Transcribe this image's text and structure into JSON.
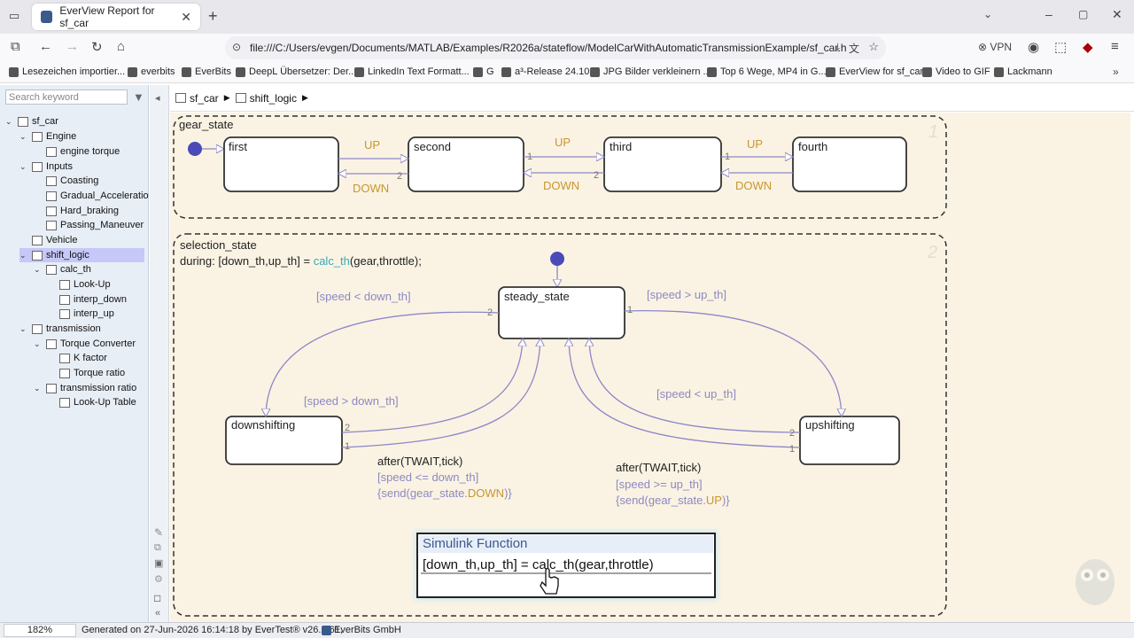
{
  "browser": {
    "tab_title": "EverView Report for sf_car",
    "url": "file:///C:/Users/evgen/Documents/MATLAB/Examples/R2026a/stateflow/ModelCarWithAutomaticTransmissionExample/sf_car.h",
    "vpn_label": "VPN",
    "bookmarks": [
      "Lesezeichen importier...",
      "everbits",
      "EverBits",
      "DeepL Übersetzer: Der...",
      "LinkedIn Text Formatt...",
      "G",
      "a³-Release 24.10",
      "JPG Bilder verkleinern ...",
      "Top 6 Wege, MP4 in G...",
      "EverView for sf_car",
      "Video to GIF",
      "Lackmann"
    ]
  },
  "sidebar": {
    "search_placeholder": "Search keyword",
    "tree": [
      {
        "label": "sf_car"
      },
      {
        "label": "Engine"
      },
      {
        "label": "engine torque"
      },
      {
        "label": "Inputs"
      },
      {
        "label": "Coasting"
      },
      {
        "label": "Gradual_Acceleratio"
      },
      {
        "label": "Hard_braking"
      },
      {
        "label": "Passing_Maneuver"
      },
      {
        "label": "Vehicle"
      },
      {
        "label": "shift_logic"
      },
      {
        "label": "calc_th"
      },
      {
        "label": "Look-Up"
      },
      {
        "label": "interp_down"
      },
      {
        "label": "interp_up"
      },
      {
        "label": "transmission"
      },
      {
        "label": "Torque Converter"
      },
      {
        "label": "K factor"
      },
      {
        "label": "Torque ratio"
      },
      {
        "label": "transmission ratio"
      },
      {
        "label": "Look-Up Table"
      }
    ]
  },
  "breadcrumb": {
    "root": "sf_car",
    "current": "shift_logic"
  },
  "diagram": {
    "gear_state": {
      "title": "gear_state",
      "num": "1",
      "states": [
        "first",
        "second",
        "third",
        "fourth"
      ],
      "up": "UP",
      "down": "DOWN",
      "p1": "1",
      "p2": "2"
    },
    "selection_state": {
      "title": "selection_state",
      "num": "2",
      "during_prefix": "during: [down_th,up_th] = ",
      "during_fn": "calc_th",
      "during_suffix": "(gear,throttle);",
      "steady": "steady_state",
      "down": "downshifting",
      "up": "upshifting",
      "g_lt_down": "[speed < down_th]",
      "g_gt_up": "[speed > up_th]",
      "g_gt_down": "[speed > down_th]",
      "g_lt_up": "[speed < up_th]",
      "down_act": [
        "after(TWAIT,tick)",
        "[speed <= down_th]",
        "{send(gear_state.",
        "DOWN",
        ")}"
      ],
      "up_act": [
        "after(TWAIT,tick)",
        "[speed >= up_th]",
        "{send(gear_state.",
        "UP",
        ")}"
      ]
    },
    "function": {
      "title": "Simulink Function",
      "signature": "[down_th,up_th] = calc_th(gear,throttle)"
    }
  },
  "status": {
    "zoom": "182%",
    "generated": "Generated on 27-Jun-2026 16:14:18 by EverTest® v26.1.61,",
    "company": "EverBits GmbH"
  },
  "colors": {
    "state_fill": "#ffffff",
    "canvas": "#faf3e3",
    "transition": "#8e86c8",
    "label": "#c8962e",
    "guard": "#8c88c4",
    "selection": "#c6c8f8"
  }
}
